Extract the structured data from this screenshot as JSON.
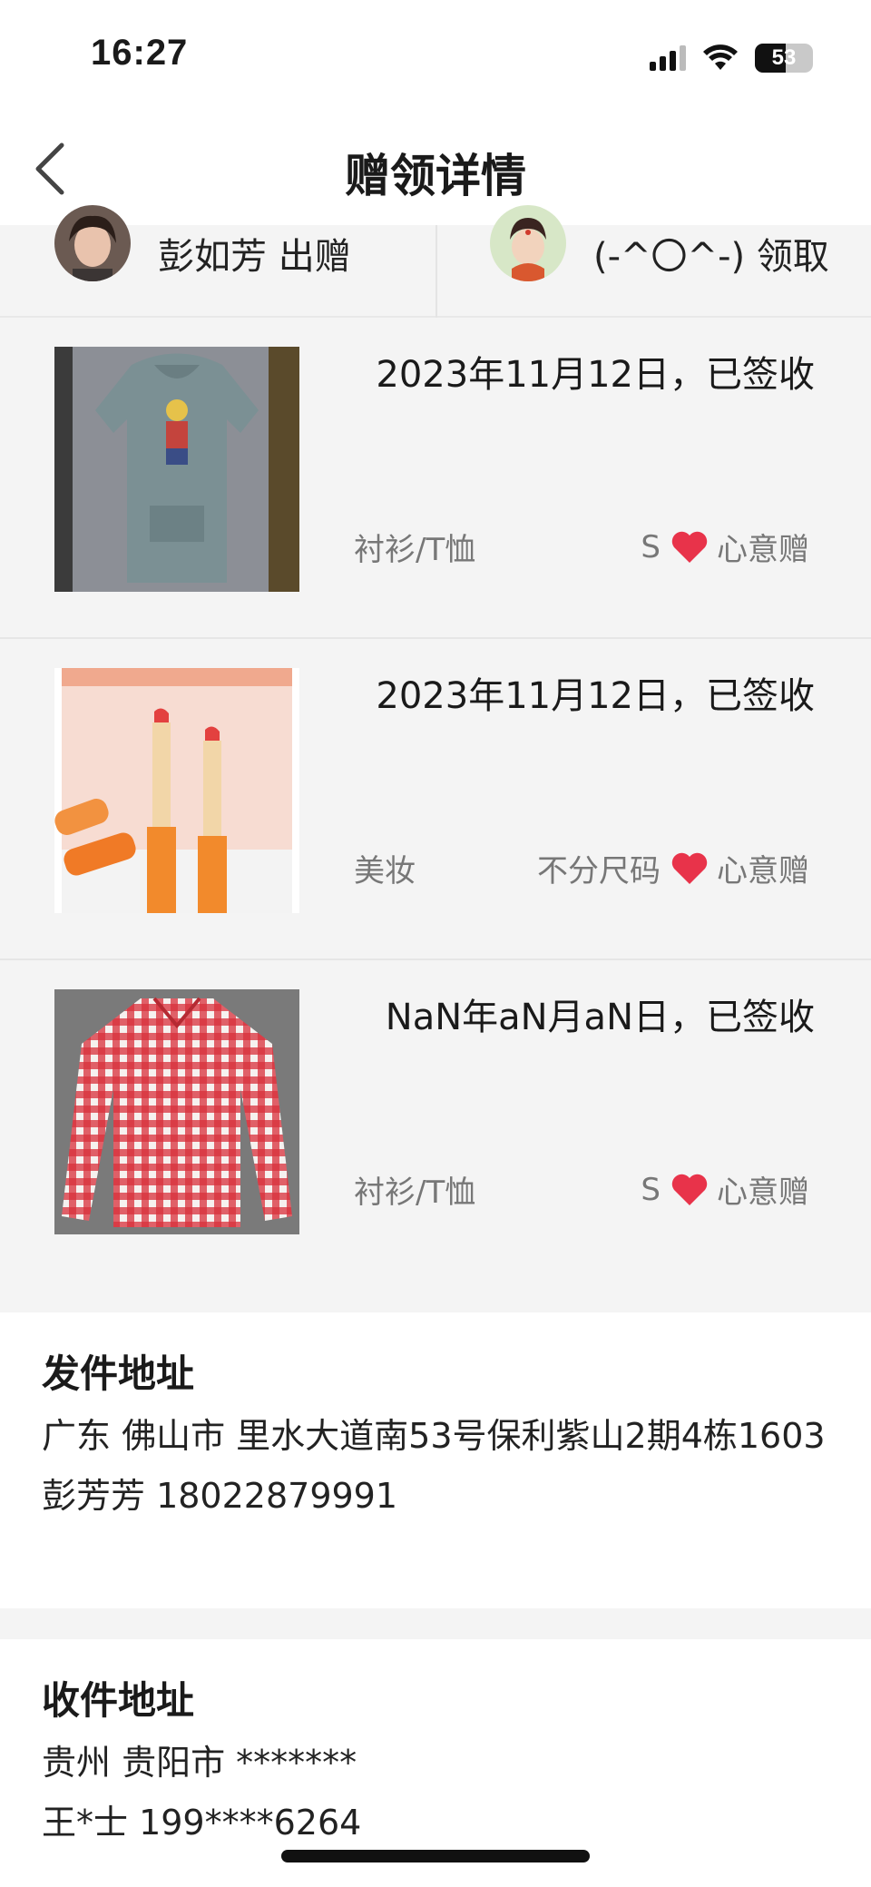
{
  "status_bar": {
    "time": "16:27",
    "battery": "53",
    "battery_level": 0.53
  },
  "nav": {
    "title": "赠领详情"
  },
  "giver": {
    "name": "彭如芳 出赠"
  },
  "receiver": {
    "name": "(-^〇^-) 领取"
  },
  "items": [
    {
      "date": "2023年11月12日，已签收",
      "category": "衬衫/T恤",
      "size": "S",
      "tag": "心意赠",
      "image": "grey-hoodie-dress"
    },
    {
      "date": "2023年11月12日，已签收",
      "category": "美妆",
      "size": "不分尺码",
      "tag": "心意赠",
      "image": "orange-lipsticks"
    },
    {
      "date": "NaN年aN月aN日，已签收",
      "category": "衬衫/T恤",
      "size": "S",
      "tag": "心意赠",
      "image": "red-plaid-shirt"
    }
  ],
  "sender_address": {
    "title": "发件地址",
    "address": "广东 佛山市 里水大道南53号保利紫山2期4栋1603",
    "contact": "彭芳芳 18022879991"
  },
  "receiver_address": {
    "title": "收件地址",
    "address": "贵州 贵阳市 *******",
    "contact": "王*士 199****6264"
  },
  "colors": {
    "heart": "#e8334a",
    "background": "#f4f4f4"
  }
}
